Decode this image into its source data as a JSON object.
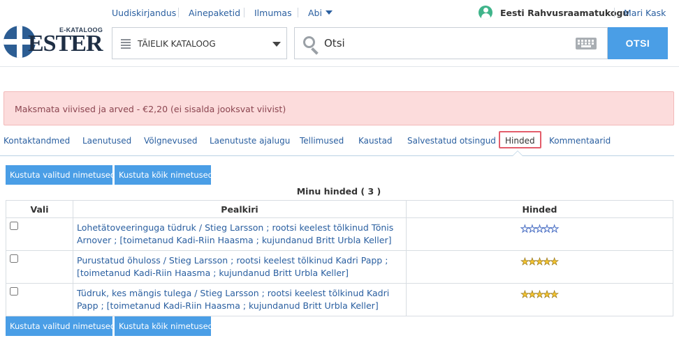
{
  "topnav": {
    "links": [
      "Uudiskirjandus",
      "Ainepaketid",
      "Ilmumas",
      "Abi"
    ],
    "library": "Eesti Rahvusraamatukogu",
    "user": "Mari Kask"
  },
  "logo": {
    "small": "E-KATALOOG",
    "name": "ESTER"
  },
  "catalog": {
    "label": "TÄIELIK KATALOOG"
  },
  "search": {
    "placeholder": "Otsi",
    "button": "OTSI"
  },
  "alert": {
    "text": "Maksmata viivised ja arved - €2,20 (ei sisalda jooksvat viivist)"
  },
  "tabs": [
    "Kontaktandmed",
    "Laenutused",
    "Võlgnevused",
    "Laenutuste ajalugu",
    "Tellimused",
    "Kaustad",
    "Salvestatud otsingud",
    "Hinded",
    "Kommentaarid"
  ],
  "buttons": {
    "delete_selected": "Kustuta valitud nimetused",
    "delete_all": "Kustuta kõik nimetused"
  },
  "table": {
    "title": "Minu hinded ( 3 )",
    "headers": [
      "Vali",
      "Pealkiri",
      "Hinded"
    ],
    "rows": [
      {
        "title": "Lohetätoveeringuga tüdruk / Stieg Larsson ; rootsi keelest tõlkinud Tõnis Arnover ; [toimetanud Kadi-Riin Haasma ; kujundanud Britt Urbla Keller]",
        "rating": 0,
        "max": 5
      },
      {
        "title": "Purustatud õhuloss / Stieg Larsson ; rootsi keelest tõlkinud Kadri Papp ; [toimetanud Kadi-Riin Haasma ; kujundanud Britt Urbla Keller]",
        "rating": 5,
        "max": 5
      },
      {
        "title": "Tüdruk, kes mängis tulega / Stieg Larsson ; rootsi keelest tõlkinud Kadri Papp ; [toimetanud Kadi-Riin Haasma ; kujundanud Britt Urbla Keller]",
        "rating": 5,
        "max": 5
      }
    ]
  }
}
